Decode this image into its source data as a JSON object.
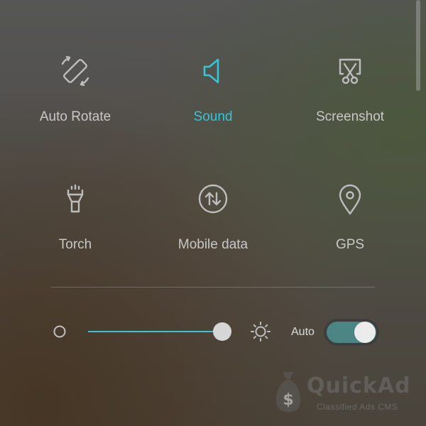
{
  "quick_settings": {
    "tiles": [
      {
        "label": "Auto Rotate",
        "icon": "rotate-icon",
        "active": false
      },
      {
        "label": "Sound",
        "icon": "speaker-icon",
        "active": true
      },
      {
        "label": "Screenshot",
        "icon": "screenshot-icon",
        "active": false
      },
      {
        "label": "Torch",
        "icon": "flashlight-icon",
        "active": false
      },
      {
        "label": "Mobile data",
        "icon": "mobile-data-icon",
        "active": false
      },
      {
        "label": "GPS",
        "icon": "location-pin-icon",
        "active": false
      }
    ]
  },
  "brightness": {
    "level_fraction": 0.92,
    "auto_label": "Auto",
    "auto_enabled": true,
    "low_icon": "brightness-low-icon",
    "high_icon": "brightness-high-icon"
  },
  "watermark": {
    "brand": "QuickAd",
    "tagline": "Classified Ads CMS",
    "icon": "money-bag-icon"
  },
  "colors": {
    "accent": "#36c4d8",
    "icon_inactive": "#bdbdbd",
    "toggle_on": "#4d8585"
  }
}
